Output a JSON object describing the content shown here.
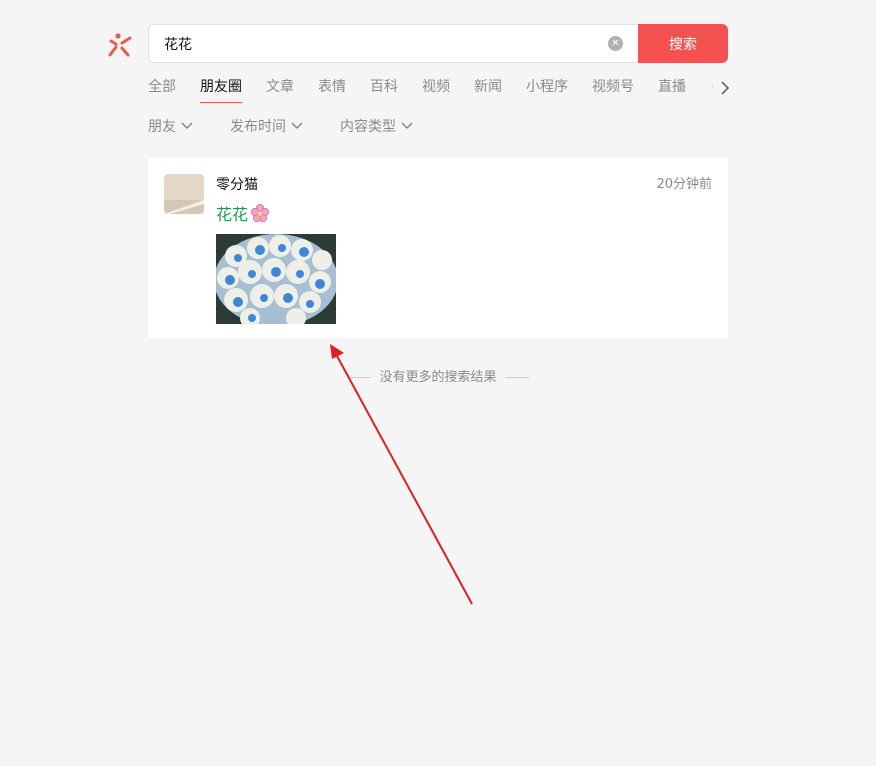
{
  "search": {
    "value": "花花",
    "clear_icon": "close-circle-icon",
    "button_label": "搜索"
  },
  "colors": {
    "accent": "#f55151",
    "post_text": "#1f9a4a",
    "annotation_arrow": "#e02020"
  },
  "tabs": [
    {
      "label": "全部"
    },
    {
      "label": "朋友圈",
      "active": true
    },
    {
      "label": "文章"
    },
    {
      "label": "表情"
    },
    {
      "label": "百科"
    },
    {
      "label": "视频"
    },
    {
      "label": "新闻"
    },
    {
      "label": "小程序"
    },
    {
      "label": "视频号"
    },
    {
      "label": "直播"
    }
  ],
  "filters": [
    {
      "label": "朋友"
    },
    {
      "label": "发布时间"
    },
    {
      "label": "内容类型"
    }
  ],
  "result": {
    "username": "零分猫",
    "time": "20分钟前",
    "text": "花花",
    "emoji_icon": "cherry-blossom-icon",
    "image_icon": "bouquet-photo"
  },
  "footer": {
    "no_more_text": "没有更多的搜索结果"
  }
}
